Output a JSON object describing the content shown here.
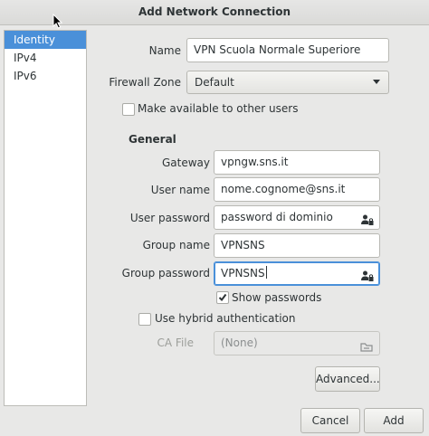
{
  "window": {
    "title": "Add Network Connection"
  },
  "sidebar": {
    "items": [
      {
        "label": "Identity",
        "selected": true
      },
      {
        "label": "IPv4",
        "selected": false
      },
      {
        "label": "IPv6",
        "selected": false
      }
    ]
  },
  "identity": {
    "name_label": "Name",
    "name_value": "VPN Scuola Normale Superiore",
    "firewall_label": "Firewall Zone",
    "firewall_value": "Default",
    "available_label": "Make available to other users",
    "available_checked": false
  },
  "general": {
    "heading": "General",
    "gateway_label": "Gateway",
    "gateway_value": "vpngw.sns.it",
    "username_label": "User name",
    "username_value": "nome.cognome@sns.it",
    "userpassword_label": "User password",
    "userpassword_value": "password di dominio",
    "groupname_label": "Group name",
    "groupname_value": "VPNSNS",
    "grouppassword_label": "Group password",
    "grouppassword_value": "VPNSNS",
    "show_passwords_label": "Show passwords",
    "show_passwords_checked": true,
    "hybrid_label": "Use hybrid authentication",
    "hybrid_checked": false,
    "cafile_label": "CA File",
    "cafile_value": "(None)",
    "advanced_label": "Advanced..."
  },
  "buttons": {
    "cancel_label": "Cancel",
    "add_label": "Add"
  },
  "colors": {
    "accent": "#4a90d9",
    "background": "#e8e8e7",
    "text": "#2e3436"
  }
}
